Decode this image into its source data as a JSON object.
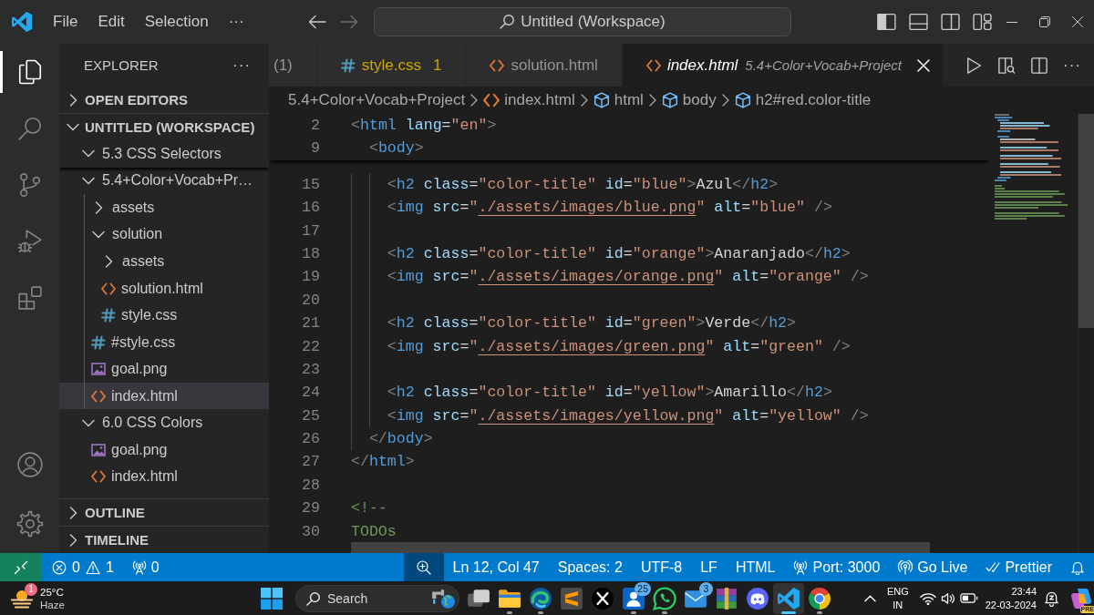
{
  "title_bar": {
    "menu": [
      "File",
      "Edit",
      "Selection"
    ],
    "menu_more": "···",
    "nav": [
      {
        "kind": "back",
        "disabled": false
      },
      {
        "kind": "forward",
        "disabled": true
      }
    ],
    "command_center": "Untitled (Workspace)",
    "layout_controls": [
      {
        "kind": "primary-sidebar",
        "on": true
      },
      {
        "kind": "panel",
        "on": false
      },
      {
        "kind": "secondary-sidebar",
        "on": false
      },
      {
        "kind": "customize"
      }
    ],
    "window_controls": [
      {
        "kind": "minimize"
      },
      {
        "kind": "restore"
      },
      {
        "kind": "close"
      }
    ]
  },
  "activity_bar": {
    "items": [
      {
        "kind": "explorer",
        "selected": true
      },
      {
        "kind": "search",
        "selected": false
      },
      {
        "kind": "source-control",
        "selected": false
      },
      {
        "kind": "run-debug",
        "selected": false
      },
      {
        "kind": "extensions",
        "selected": false
      }
    ],
    "bottom": [
      {
        "kind": "accounts"
      },
      {
        "kind": "settings"
      }
    ]
  },
  "sidebar": {
    "title": "EXPLORER",
    "more": "···",
    "sections": [
      {
        "label": "OPEN EDITORS",
        "expanded": false
      },
      {
        "label": "UNTITLED (WORKSPACE)",
        "expanded": true,
        "children": [
          {
            "label": "5.3 CSS Selectors",
            "kind": "folder",
            "expanded": true,
            "sticky": true,
            "selected": false
          },
          {
            "label": "5.4+Color+Vocab+Pr…",
            "kind": "folder",
            "expanded": true,
            "sticky": false,
            "selected": false,
            "children": [
              {
                "label": "assets",
                "kind": "folder",
                "expanded": false,
                "selected": false
              },
              {
                "label": "solution",
                "kind": "folder",
                "expanded": true,
                "selected": false,
                "children": [
                  {
                    "label": "assets",
                    "kind": "folder",
                    "expanded": false,
                    "selected": false
                  },
                  {
                    "label": "solution.html",
                    "kind": "html",
                    "selected": false
                  },
                  {
                    "label": "style.css",
                    "kind": "css",
                    "selected": false
                  }
                ]
              },
              {
                "label": "#style.css",
                "kind": "css",
                "selected": false
              },
              {
                "label": "goal.png",
                "kind": "image",
                "selected": false
              },
              {
                "label": "index.html",
                "kind": "html",
                "selected": true
              }
            ]
          },
          {
            "label": "6.0 CSS Colors",
            "kind": "folder",
            "expanded": true,
            "sticky": false,
            "selected": false,
            "children": [
              {
                "label": "goal.png",
                "kind": "image",
                "selected": false
              },
              {
                "label": "index.html",
                "kind": "html",
                "selected": false
              }
            ]
          }
        ]
      },
      {
        "label": "OUTLINE",
        "expanded": false
      },
      {
        "label": "TIMELINE",
        "expanded": false
      }
    ]
  },
  "editor": {
    "tabs": [
      {
        "label": "(1)",
        "warning": false,
        "preview": false,
        "selected": false
      },
      {
        "label": "style.css",
        "kind": "css",
        "badge": "1",
        "warning": true,
        "preview": false,
        "selected": false
      },
      {
        "label": "solution.html",
        "kind": "html",
        "warning": false,
        "preview": false,
        "selected": false
      },
      {
        "label": "index.html",
        "kind": "html",
        "description": "5.4+Color+Vocab+Project",
        "warning": false,
        "preview": true,
        "selected": true
      }
    ],
    "actions": [
      {
        "kind": "run"
      },
      {
        "kind": "preview"
      },
      {
        "kind": "split"
      }
    ],
    "more": "···",
    "breadcrumbs": [
      {
        "label": "5.4+Color+Vocab+Project",
        "kind": "folder"
      },
      {
        "label": "index.html",
        "kind": "html"
      },
      {
        "label": "html",
        "kind": "element"
      },
      {
        "label": "body",
        "kind": "element"
      },
      {
        "label": "h2#red.color-title",
        "kind": "element"
      }
    ],
    "sticky_lines": [
      {
        "number": "2",
        "tokens": [
          {
            "kind": "bracket",
            "text": "<"
          },
          {
            "kind": "tag",
            "text": "html"
          },
          {
            "kind": "attr",
            "text": " lang"
          },
          {
            "kind": "equals",
            "text": "="
          },
          {
            "kind": "string",
            "text": "\"en\""
          },
          {
            "kind": "bracket",
            "text": ">"
          }
        ]
      },
      {
        "number": "9",
        "tokens": [
          {
            "kind": "bracket",
            "text": "  <"
          },
          {
            "kind": "tag",
            "text": "body"
          },
          {
            "kind": "bracket",
            "text": ">"
          }
        ]
      }
    ],
    "lines": [
      {
        "number": "15",
        "tokens": [
          {
            "kind": "bracket",
            "text": "    <"
          },
          {
            "kind": "tag",
            "text": "h2"
          },
          {
            "kind": "attr",
            "text": " class"
          },
          {
            "kind": "equals",
            "text": "="
          },
          {
            "kind": "string",
            "text": "\"color-title\""
          },
          {
            "kind": "attr",
            "text": " id"
          },
          {
            "kind": "equals",
            "text": "="
          },
          {
            "kind": "string",
            "text": "\"blue\""
          },
          {
            "kind": "bracket",
            "text": ">"
          },
          {
            "kind": "text",
            "text": "Azul"
          },
          {
            "kind": "bracket",
            "text": "</"
          },
          {
            "kind": "tag",
            "text": "h2"
          },
          {
            "kind": "bracket",
            "text": ">"
          }
        ]
      },
      {
        "number": "16",
        "tokens": [
          {
            "kind": "bracket",
            "text": "    <"
          },
          {
            "kind": "tag",
            "text": "img"
          },
          {
            "kind": "attr",
            "text": " src"
          },
          {
            "kind": "equals",
            "text": "="
          },
          {
            "kind": "string",
            "text": "\""
          },
          {
            "kind": "link",
            "text": "./assets/images/blue.png"
          },
          {
            "kind": "string",
            "text": "\""
          },
          {
            "kind": "attr",
            "text": " alt"
          },
          {
            "kind": "equals",
            "text": "="
          },
          {
            "kind": "string",
            "text": "\"blue\""
          },
          {
            "kind": "bracket",
            "text": " />"
          }
        ]
      },
      {
        "number": "17"
      },
      {
        "number": "18",
        "tokens": [
          {
            "kind": "bracket",
            "text": "    <"
          },
          {
            "kind": "tag",
            "text": "h2"
          },
          {
            "kind": "attr",
            "text": " class"
          },
          {
            "kind": "equals",
            "text": "="
          },
          {
            "kind": "string",
            "text": "\"color-title\""
          },
          {
            "kind": "attr",
            "text": " id"
          },
          {
            "kind": "equals",
            "text": "="
          },
          {
            "kind": "string",
            "text": "\"orange\""
          },
          {
            "kind": "bracket",
            "text": ">"
          },
          {
            "kind": "text",
            "text": "Anaranjado"
          },
          {
            "kind": "bracket",
            "text": "</"
          },
          {
            "kind": "tag",
            "text": "h2"
          },
          {
            "kind": "bracket",
            "text": ">"
          }
        ]
      },
      {
        "number": "19",
        "tokens": [
          {
            "kind": "bracket",
            "text": "    <"
          },
          {
            "kind": "tag",
            "text": "img"
          },
          {
            "kind": "attr",
            "text": " src"
          },
          {
            "kind": "equals",
            "text": "="
          },
          {
            "kind": "string",
            "text": "\""
          },
          {
            "kind": "link",
            "text": "./assets/images/orange.png"
          },
          {
            "kind": "string",
            "text": "\""
          },
          {
            "kind": "attr",
            "text": " alt"
          },
          {
            "kind": "equals",
            "text": "="
          },
          {
            "kind": "string",
            "text": "\"orange\""
          },
          {
            "kind": "bracket",
            "text": " />"
          }
        ]
      },
      {
        "number": "20"
      },
      {
        "number": "21",
        "tokens": [
          {
            "kind": "bracket",
            "text": "    <"
          },
          {
            "kind": "tag",
            "text": "h2"
          },
          {
            "kind": "attr",
            "text": " class"
          },
          {
            "kind": "equals",
            "text": "="
          },
          {
            "kind": "string",
            "text": "\"color-title\""
          },
          {
            "kind": "attr",
            "text": " id"
          },
          {
            "kind": "equals",
            "text": "="
          },
          {
            "kind": "string",
            "text": "\"green\""
          },
          {
            "kind": "bracket",
            "text": ">"
          },
          {
            "kind": "text",
            "text": "Verde"
          },
          {
            "kind": "bracket",
            "text": "</"
          },
          {
            "kind": "tag",
            "text": "h2"
          },
          {
            "kind": "bracket",
            "text": ">"
          }
        ]
      },
      {
        "number": "22",
        "tokens": [
          {
            "kind": "bracket",
            "text": "    <"
          },
          {
            "kind": "tag",
            "text": "img"
          },
          {
            "kind": "attr",
            "text": " src"
          },
          {
            "kind": "equals",
            "text": "="
          },
          {
            "kind": "string",
            "text": "\""
          },
          {
            "kind": "link",
            "text": "./assets/images/green.png"
          },
          {
            "kind": "string",
            "text": "\""
          },
          {
            "kind": "attr",
            "text": " alt"
          },
          {
            "kind": "equals",
            "text": "="
          },
          {
            "kind": "string",
            "text": "\"green\""
          },
          {
            "kind": "bracket",
            "text": " />"
          }
        ]
      },
      {
        "number": "23"
      },
      {
        "number": "24",
        "tokens": [
          {
            "kind": "bracket",
            "text": "    <"
          },
          {
            "kind": "tag",
            "text": "h2"
          },
          {
            "kind": "attr",
            "text": " class"
          },
          {
            "kind": "equals",
            "text": "="
          },
          {
            "kind": "string",
            "text": "\"color-title\""
          },
          {
            "kind": "attr",
            "text": " id"
          },
          {
            "kind": "equals",
            "text": "="
          },
          {
            "kind": "string",
            "text": "\"yellow\""
          },
          {
            "kind": "bracket",
            "text": ">"
          },
          {
            "kind": "text",
            "text": "Amarillo"
          },
          {
            "kind": "bracket",
            "text": "</"
          },
          {
            "kind": "tag",
            "text": "h2"
          },
          {
            "kind": "bracket",
            "text": ">"
          }
        ]
      },
      {
        "number": "25",
        "tokens": [
          {
            "kind": "bracket",
            "text": "    <"
          },
          {
            "kind": "tag",
            "text": "img"
          },
          {
            "kind": "attr",
            "text": " src"
          },
          {
            "kind": "equals",
            "text": "="
          },
          {
            "kind": "string",
            "text": "\""
          },
          {
            "kind": "link",
            "text": "./assets/images/yellow.png"
          },
          {
            "kind": "string",
            "text": "\""
          },
          {
            "kind": "attr",
            "text": " alt"
          },
          {
            "kind": "equals",
            "text": "="
          },
          {
            "kind": "string",
            "text": "\"yellow\""
          },
          {
            "kind": "bracket",
            "text": " />"
          }
        ]
      },
      {
        "number": "26",
        "tokens": [
          {
            "kind": "bracket",
            "text": "  </"
          },
          {
            "kind": "tag",
            "text": "body"
          },
          {
            "kind": "bracket",
            "text": ">"
          }
        ]
      },
      {
        "number": "27",
        "tokens": [
          {
            "kind": "bracket",
            "text": "</"
          },
          {
            "kind": "tag",
            "text": "html"
          },
          {
            "kind": "bracket",
            "text": ">"
          }
        ]
      },
      {
        "number": "28"
      },
      {
        "number": "29",
        "tokens": [
          {
            "kind": "comment",
            "text": "<!--"
          }
        ]
      },
      {
        "number": "30",
        "tokens": [
          {
            "kind": "comment",
            "text": "TODOs"
          }
        ]
      }
    ]
  },
  "status_bar": {
    "items": [
      {
        "kind": "remote"
      },
      {
        "kind": "problems",
        "errors": "0",
        "warnings": "1"
      },
      {
        "kind": "ports",
        "text": "0"
      },
      {
        "kind": "zoom"
      },
      {
        "kind": "position",
        "text": "Ln 12, Col 47"
      },
      {
        "kind": "indentation",
        "text": "Spaces: 2"
      },
      {
        "kind": "encoding",
        "text": "UTF-8"
      },
      {
        "kind": "line-ending",
        "text": "LF"
      },
      {
        "kind": "language",
        "text": "HTML"
      },
      {
        "kind": "port",
        "text": "Port: 3000"
      },
      {
        "kind": "live",
        "text": "Go Live"
      },
      {
        "kind": "formatter",
        "text": "Prettier"
      },
      {
        "kind": "notifications"
      }
    ]
  },
  "taskbar": {
    "weather": {
      "badge": "1",
      "temperature": "25°C",
      "condition": "Haze"
    },
    "search": {
      "placeholder": "Search"
    },
    "apps": [
      {
        "kind": "task-view",
        "running": false,
        "selected": false
      },
      {
        "kind": "folder",
        "running": true,
        "selected": false
      },
      {
        "kind": "swirl",
        "running": true,
        "selected": false
      },
      {
        "kind": "stripes",
        "running": false,
        "selected": false
      },
      {
        "kind": "cross",
        "running": false,
        "selected": false
      },
      {
        "kind": "tile",
        "badge": "25",
        "running": true,
        "selected": false
      },
      {
        "kind": "chat",
        "running": true,
        "selected": false
      },
      {
        "kind": "envelope",
        "badge": "3",
        "running": false,
        "selected": false
      },
      {
        "kind": "books",
        "running": false,
        "selected": false
      },
      {
        "kind": "face",
        "running": false,
        "selected": false
      },
      {
        "kind": "ribbon",
        "running": true,
        "selected": true
      },
      {
        "kind": "ring",
        "running": true,
        "selected": false
      }
    ],
    "tray": {
      "language": "ENG",
      "region": "IN",
      "time": "23:44",
      "date": "22-03-2024",
      "assistant_badge": "PRE"
    }
  }
}
